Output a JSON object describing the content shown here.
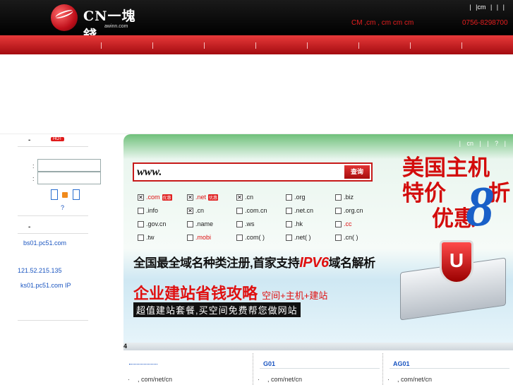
{
  "header": {
    "logo_title": "CN一塊錢",
    "logo_sub": "awinn.com",
    "top_links": "|    |cm   |    |    |",
    "info_text": "CM  ,cm      ,  cm   cm     cm",
    "phone": "0756-8298700"
  },
  "sidebar": {
    "section1_title": "-",
    "hot_badge": "HOT",
    "colon1": ":",
    "colon2": ":",
    "help_mark": "?",
    "section2_title": "-",
    "dns1": "bs01.pc51.com",
    "ip": "121.52.215.135",
    "dns2": "ks01.pc51.com  IP"
  },
  "main": {
    "top_links": "|  cn  |    |  ?  |",
    "search_value": "www.",
    "search_button": "查询",
    "tlds": [
      {
        "label": ".com",
        "checked": true,
        "red": true,
        "badge": "优惠"
      },
      {
        "label": ".net",
        "checked": true,
        "red": true,
        "badge": "优惠"
      },
      {
        "label": ".cn",
        "checked": true,
        "red": false,
        "badge": ""
      },
      {
        "label": ".org",
        "checked": false,
        "red": false,
        "badge": ""
      },
      {
        "label": ".biz",
        "checked": false,
        "red": false,
        "badge": ""
      },
      {
        "label": ".info",
        "checked": false,
        "red": false,
        "badge": ""
      },
      {
        "label": ".cn",
        "checked": true,
        "red": false,
        "badge": ""
      },
      {
        "label": ".com.cn",
        "checked": false,
        "red": false,
        "badge": ""
      },
      {
        "label": ".net.cn",
        "checked": false,
        "red": false,
        "badge": ""
      },
      {
        "label": ".org.cn",
        "checked": false,
        "red": false,
        "badge": ""
      },
      {
        "label": ".gov.cn",
        "checked": false,
        "red": false,
        "badge": ""
      },
      {
        "label": ".name",
        "checked": false,
        "red": false,
        "badge": ""
      },
      {
        "label": ".ws",
        "checked": false,
        "red": false,
        "badge": ""
      },
      {
        "label": ".hk",
        "checked": false,
        "red": false,
        "badge": ""
      },
      {
        "label": ".cc",
        "checked": false,
        "red": true,
        "badge": ""
      },
      {
        "label": ".tw",
        "checked": false,
        "red": false,
        "badge": ""
      },
      {
        "label": ".mobi",
        "checked": false,
        "red": true,
        "badge": ""
      },
      {
        "label": ".com(  )",
        "checked": false,
        "red": false,
        "badge": ""
      },
      {
        "label": ".net(  )",
        "checked": false,
        "red": false,
        "badge": ""
      },
      {
        "label": ".cn(  )",
        "checked": false,
        "red": false,
        "badge": ""
      }
    ],
    "promo_line1_a": "全国最全域名种类注册,首家支持",
    "promo_line1_b": "IPV6",
    "promo_line1_c": "域名解析",
    "promo_line2": "企业建站省钱攻略",
    "promo_line2_small": "空间+主机+建站",
    "promo_line3": "超值建站套餐,买空间免费帮您做网站",
    "usa_line1": "美国主机",
    "usa_line2": "特价",
    "usa_eight": "8",
    "usa_zhe": "折",
    "usa_line3": "优惠",
    "shield_letter": "U"
  },
  "strip": {
    "label": "4"
  },
  "footer": {
    "col2_title": "G01",
    "col3_title": "AG01",
    "col1_text": ",  com/net/cn",
    "col2_text": ",  com/net/cn",
    "col3_text": ",  com/net/cn"
  },
  "colors": {
    "brand_red": "#d30c0c",
    "link_blue": "#1a55c0"
  }
}
